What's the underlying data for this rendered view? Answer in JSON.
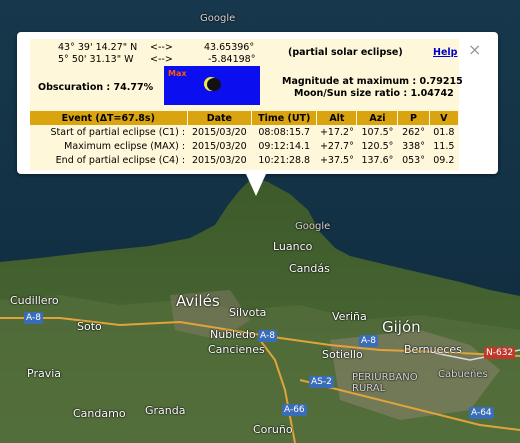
{
  "coords": {
    "lat_dms": "43° 39' 14.27\" N",
    "lon_dms": "5° 50' 31.13\" W",
    "arrow": "<-->",
    "lat_dec": "43.65396°",
    "lon_dec": "-5.84198°"
  },
  "eclipse_type": "(partial solar eclipse)",
  "help_label": "Help",
  "obscuration": "Obscuration : 74.77%",
  "max_label": "Max",
  "magnitude": "Magnitude at maximum : 0.79215",
  "size_ratio": "Moon/Sun size ratio : 1.04742",
  "table": {
    "headers": [
      "Event (ΔT=67.8s)",
      "Date",
      "Time (UT)",
      "Alt",
      "Azi",
      "P",
      "V"
    ],
    "rows": [
      [
        "Start of partial eclipse (C1) :",
        "2015/03/20",
        "08:08:15.7",
        "+17.2°",
        "107.5°",
        "262°",
        "01.8"
      ],
      [
        "Maximum eclipse (MAX) :",
        "2015/03/20",
        "09:12:14.1",
        "+27.7°",
        "120.5°",
        "338°",
        "11.5"
      ],
      [
        "End of partial eclipse (C4) :",
        "2015/03/20",
        "10:21:28.8",
        "+37.5°",
        "137.6°",
        "053°",
        "09.2"
      ]
    ]
  },
  "close_symbol": "×",
  "map": {
    "places": [
      "Luanco",
      "Candás",
      "Cudillero",
      "Avilés",
      "Silvota",
      "Nubledo",
      "Cancienes",
      "Veriña",
      "Gijón",
      "Soto",
      "Sotiello",
      "Bernueces",
      "Pravia",
      "Candamo",
      "Granda",
      "Coruño",
      "PERIURBANO RURAL",
      "Cabueñes",
      "Google"
    ],
    "roads": [
      "A-8",
      "A-8",
      "A-8",
      "AS-2",
      "A-66",
      "A-64",
      "N-632"
    ]
  }
}
